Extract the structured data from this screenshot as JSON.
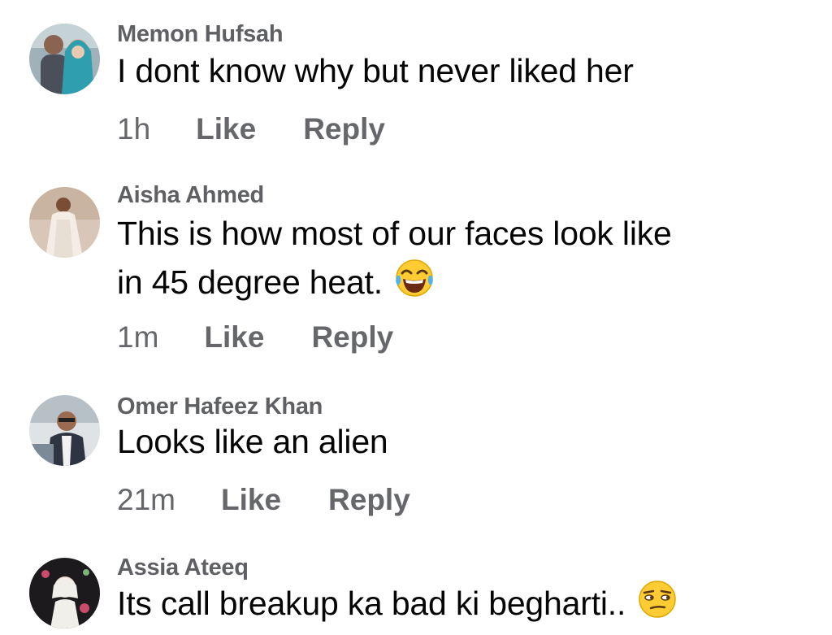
{
  "comments": [
    {
      "author": "Memon Hufsah",
      "lines": [
        "I dont know why but never liked her"
      ],
      "time": "1h",
      "like_label": "Like",
      "reply_label": "Reply"
    },
    {
      "author": "Aisha Ahmed",
      "lines": [
        "This is how most of our faces look like",
        "in 45 degree heat."
      ],
      "time": "1m",
      "like_label": "Like",
      "reply_label": "Reply",
      "emoji": "face-with-tears-of-joy"
    },
    {
      "author": "Omer Hafeez Khan",
      "lines": [
        "Looks like an alien"
      ],
      "time": "21m",
      "like_label": "Like",
      "reply_label": "Reply"
    },
    {
      "author": "Assia Ateeq",
      "lines": [
        "Its call breakup ka bad ki begharti.."
      ],
      "emoji": "unamused-face"
    }
  ],
  "colors": {
    "author": "#5f6063",
    "text": "#050505",
    "meta": "#65676b",
    "background": "#ffffff"
  }
}
